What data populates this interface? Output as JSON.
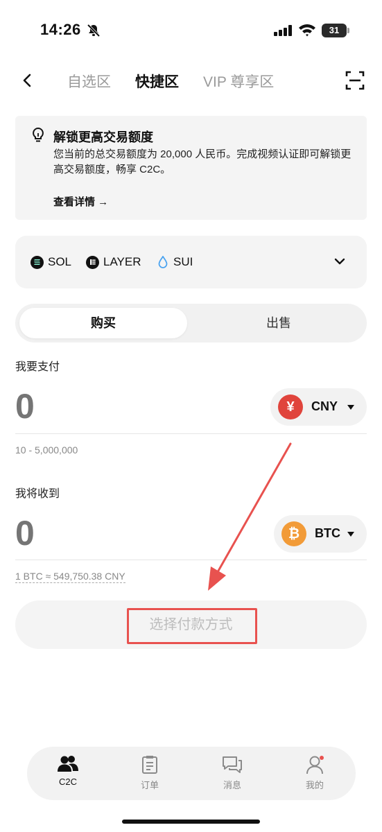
{
  "status_bar": {
    "time": "14:26",
    "battery": "31"
  },
  "nav": {
    "tabs": [
      {
        "label": "自选区",
        "active": false
      },
      {
        "label": "快捷区",
        "active": true
      },
      {
        "label": "VIP 尊享区",
        "active": false
      }
    ]
  },
  "notice": {
    "title": "解锁更高交易额度",
    "body": "您当前的总交易额度为 20,000 人民币。完成视频认证即可解锁更高交易额度，畅享 C2C。",
    "link": "查看详情 →"
  },
  "coins": [
    {
      "label": "SOL",
      "icon": "sol-icon"
    },
    {
      "label": "LAYER",
      "icon": "layer-icon"
    },
    {
      "label": "SUI",
      "icon": "sui-icon"
    }
  ],
  "toggle": {
    "buy": "购买",
    "sell": "出售"
  },
  "pay": {
    "label": "我要支付",
    "amount": "0",
    "currency": "CNY",
    "currency_symbol": "¥",
    "range": "10 - 5,000,000"
  },
  "receive": {
    "label": "我将收到",
    "amount": "0",
    "currency": "BTC",
    "currency_symbol": "₿",
    "rate": "1 BTC ≈ 549,750.38 CNY"
  },
  "action": {
    "select_payment": "选择付款方式"
  },
  "bottom_nav": [
    {
      "label": "C2C",
      "icon": "users-icon",
      "active": true
    },
    {
      "label": "订单",
      "icon": "clipboard-icon",
      "active": false
    },
    {
      "label": "消息",
      "icon": "chat-icon",
      "active": false
    },
    {
      "label": "我的",
      "icon": "profile-icon",
      "active": false
    }
  ],
  "colors": {
    "accent_red": "#e8524f",
    "cny_red": "#e0443c",
    "btc_orange": "#f29b38",
    "panel_bg": "#f4f4f4"
  }
}
